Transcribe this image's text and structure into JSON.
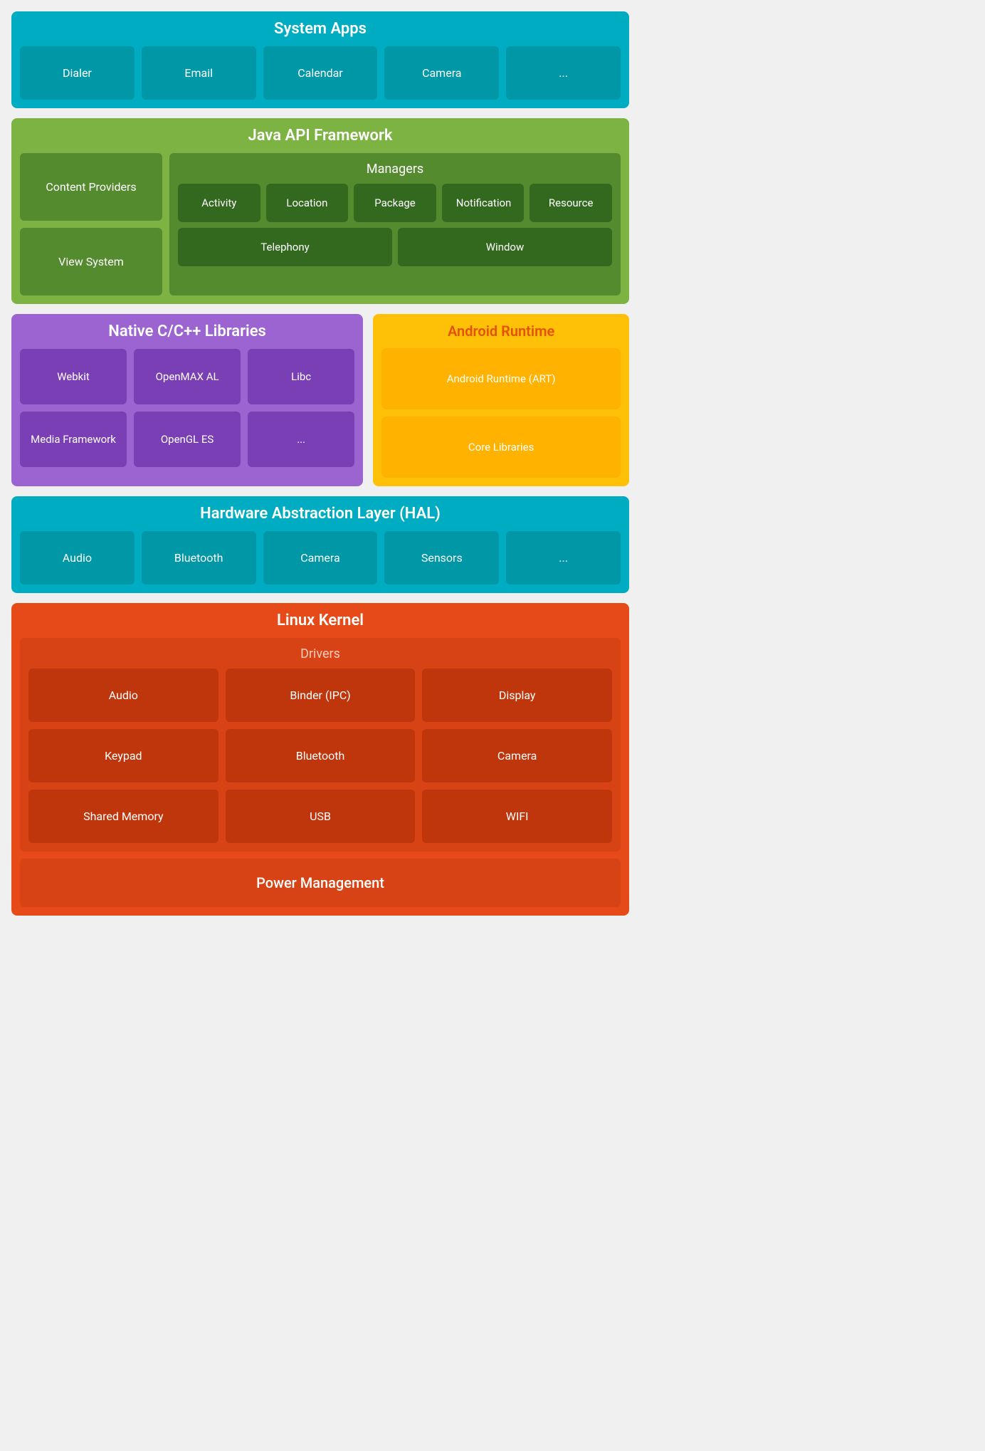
{
  "systemApps": {
    "title": "System Apps",
    "cards": [
      "Dialer",
      "Email",
      "Calendar",
      "Camera",
      "..."
    ]
  },
  "javaApi": {
    "title": "Java API Framework",
    "leftCards": [
      "Content Providers",
      "View System"
    ],
    "managers": {
      "title": "Managers",
      "items": [
        "Activity",
        "Location",
        "Package",
        "Notification",
        "Resource",
        "Telephony",
        "Window"
      ]
    }
  },
  "nativeLibs": {
    "title": "Native C/C++ Libraries",
    "cards": [
      "Webkit",
      "OpenMAX AL",
      "Libc",
      "Media Framework",
      "OpenGL ES",
      "..."
    ]
  },
  "androidRuntime": {
    "title": "Android Runtime",
    "cards": [
      "Android Runtime (ART)",
      "Core Libraries"
    ]
  },
  "hal": {
    "title": "Hardware Abstraction Layer (HAL)",
    "cards": [
      "Audio",
      "Bluetooth",
      "Camera",
      "Sensors",
      "..."
    ]
  },
  "linuxKernel": {
    "title": "Linux Kernel",
    "drivers": {
      "title": "Drivers",
      "items": [
        "Audio",
        "Binder (IPC)",
        "Display",
        "Keypad",
        "Bluetooth",
        "Camera",
        "Shared Memory",
        "USB",
        "WIFI"
      ]
    },
    "powerManagement": "Power Management"
  }
}
